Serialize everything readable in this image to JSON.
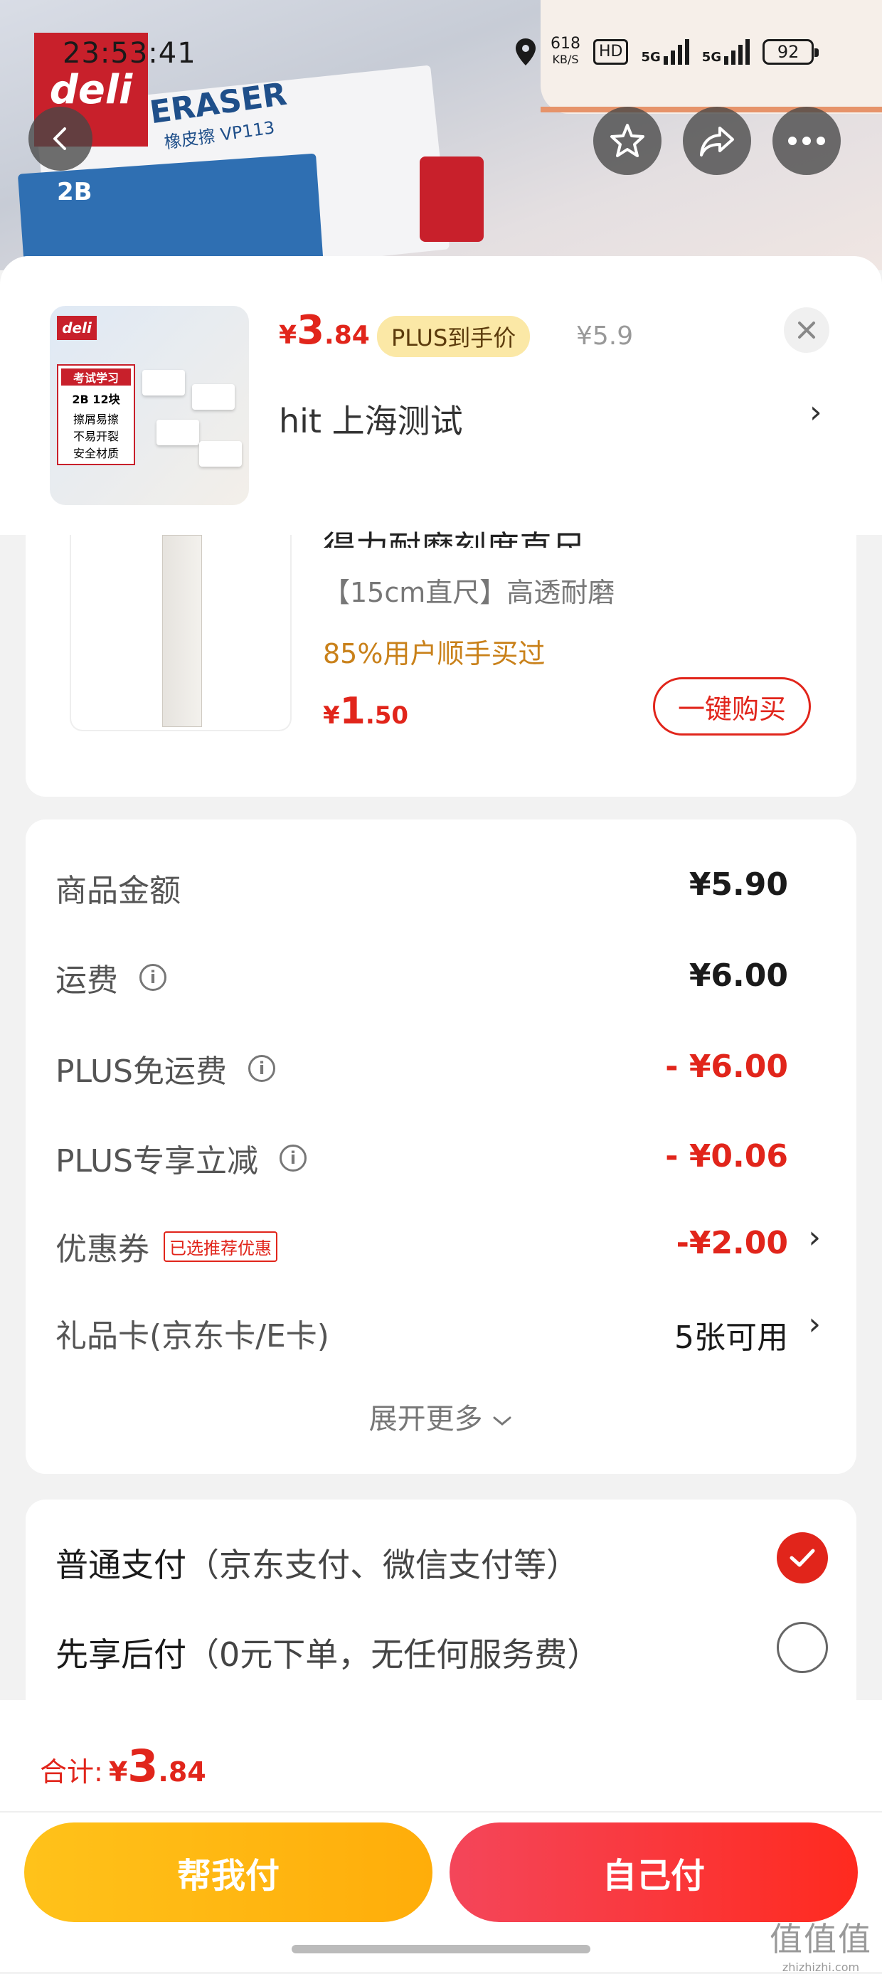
{
  "status": {
    "time": "23:53:41",
    "net_speed": "618",
    "net_unit": "KB/S",
    "hd": "HD",
    "net1": "5G",
    "net2": "5G",
    "battery": "92"
  },
  "background": {
    "brand_logo": "deli",
    "box_text": "ERASER",
    "box_sub": "橡皮擦 VP113",
    "box_grade": "2B"
  },
  "header": {
    "price_currency": "¥",
    "price_int": "3",
    "price_dec": ".84",
    "plus_tag": "PLUS到手价",
    "original_price": "¥5.9",
    "address": "hit  上海测试",
    "thumb_logo": "deli",
    "thumb_label1": "考试学习",
    "thumb_label2": "2B 12块",
    "thumb_features": [
      "擦屑易擦",
      "不易开裂",
      "安全材质"
    ]
  },
  "upsell": {
    "title": "得力耐磨刻度直尺",
    "spec": "【15cm直尺】高透耐磨",
    "stat": "85%用户顺手买过",
    "price_currency": "¥",
    "price_int": "1",
    "price_dec": ".50",
    "buy_button": "一键购买"
  },
  "summary": {
    "rows": [
      {
        "label": "商品金额",
        "value": "¥5.90"
      },
      {
        "label": "运费",
        "value": "¥6.00"
      },
      {
        "label": "PLUS免运费",
        "value": "- ¥6.00"
      },
      {
        "label": "PLUS专享立减",
        "value": "- ¥0.06"
      },
      {
        "label": "优惠券",
        "tag": "已选推荐优惠",
        "value": "-¥2.00"
      },
      {
        "label": "礼品卡(京东卡/E卡)",
        "value": "5张可用"
      }
    ],
    "expand": "展开更多"
  },
  "payment": {
    "option1_main": "普通支付",
    "option1_sub": "（京东支付、微信支付等）",
    "option2_main": "先享后付",
    "option2_sub": "（0元下单，无任何服务费）"
  },
  "footer": {
    "total_label": "合计:",
    "total_currency": "¥",
    "total_int": "3",
    "total_dec": ".84",
    "help_pay": "帮我付",
    "self_pay": "自己付"
  },
  "watermark": {
    "text": "值值值",
    "url": "zhizhizhi.com"
  },
  "colors": {
    "accent": "#e1251b",
    "plus_tag_bg": "#fbe8a6",
    "yellow_button": "#ffb812",
    "red_button": "#f52f35"
  },
  "icons": [
    "back-icon",
    "star-icon",
    "share-icon",
    "more-icon",
    "close-icon",
    "chevron-right-icon",
    "info-icon",
    "check-icon",
    "location-icon"
  ]
}
